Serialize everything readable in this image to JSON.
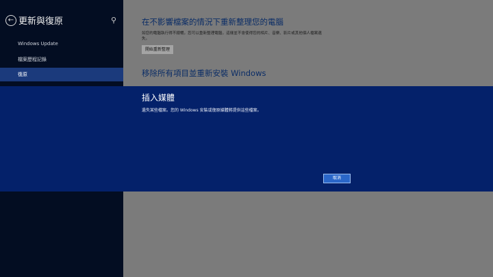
{
  "sidebar": {
    "title": "更新與復原",
    "back_glyph": "←",
    "search_glyph": "⚲",
    "items": [
      {
        "label": "Windows Update"
      },
      {
        "label": "檔案歷程記錄"
      },
      {
        "label": "復原"
      }
    ],
    "selected_index": 2
  },
  "main": {
    "refresh": {
      "title": "在不影響檔案的情況下重新整理您的電腦",
      "desc": "如您的電腦執行得不順暢，您可以重新整理電腦，這樣並不會使得您的相片、音樂、影片或其他個人檔案遺失。",
      "button": "開始重新整理"
    },
    "reset": {
      "title": "移除所有項目並重新安裝 Windows"
    }
  },
  "dialog": {
    "title": "插入媒體",
    "message": "遺失某些檔案。您的 Windows 安裝或復原媒體將提供這些檔案。",
    "cancel": "取消"
  },
  "colors": {
    "sidebar_bg": "#030d22",
    "selected_bg": "#1b3a7c",
    "dialog_bg": "#04216a",
    "button_accent": "#2a67c9"
  }
}
